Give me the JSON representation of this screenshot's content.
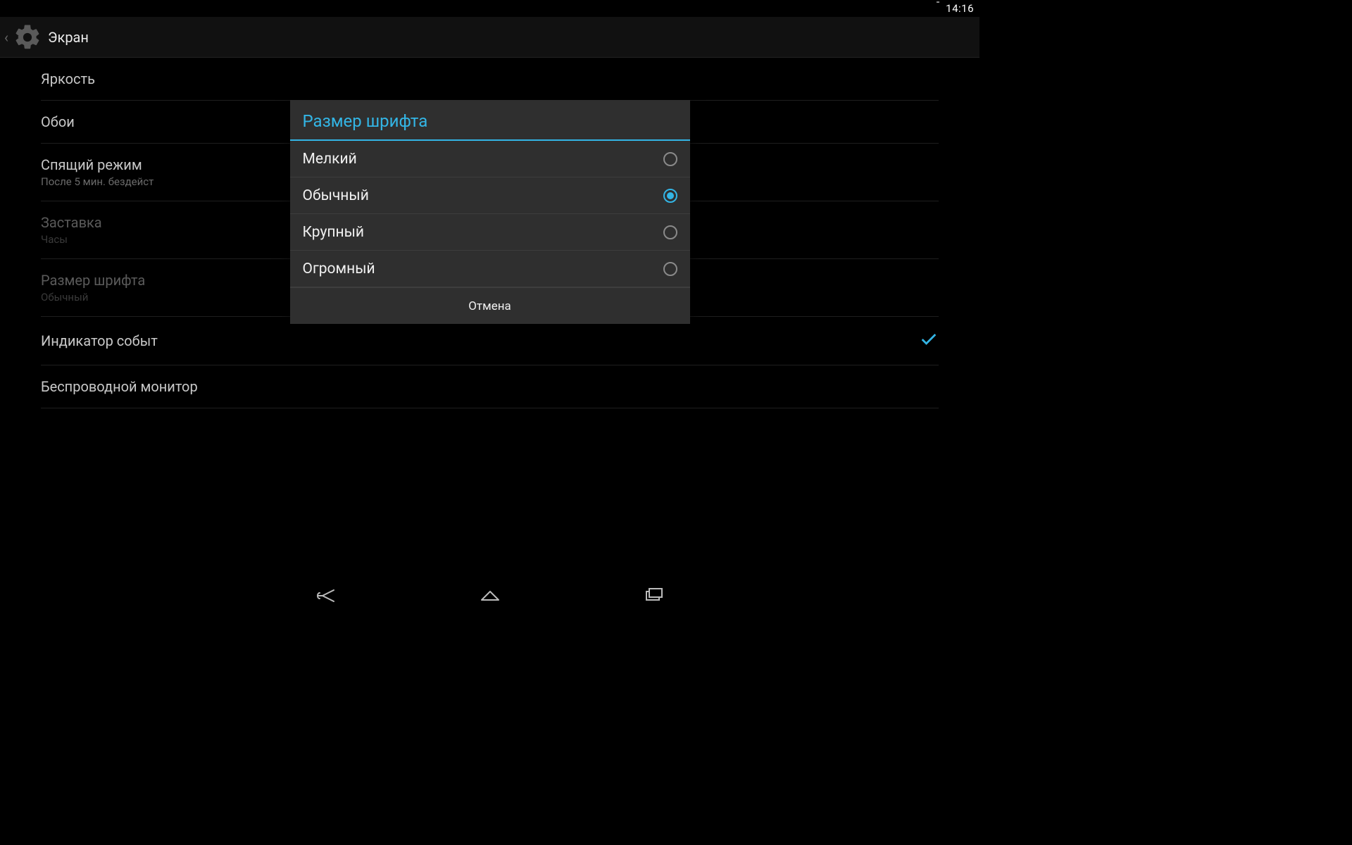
{
  "status": {
    "time": "14:16"
  },
  "actionbar": {
    "title": "Экран"
  },
  "settings": {
    "items": [
      {
        "title": "Яркость",
        "sub": ""
      },
      {
        "title": "Обои",
        "sub": ""
      },
      {
        "title": "Спящий режим",
        "sub": "После 5 мин. бездейст"
      },
      {
        "title": "Заставка",
        "sub": "Часы"
      },
      {
        "title": "Размер шрифта",
        "sub": "Обычный"
      },
      {
        "title": "Индикатор событ",
        "sub": "",
        "checked": true
      },
      {
        "title": "Беспроводной монитор",
        "sub": ""
      }
    ]
  },
  "dialog": {
    "title": "Размер шрифта",
    "options": [
      {
        "label": "Мелкий",
        "selected": false
      },
      {
        "label": "Обычный",
        "selected": true
      },
      {
        "label": "Крупный",
        "selected": false
      },
      {
        "label": "Огромный",
        "selected": false
      }
    ],
    "cancel": "Отмена"
  },
  "colors": {
    "accent": "#33b5e5",
    "dialogBg": "#2f2f2f"
  }
}
